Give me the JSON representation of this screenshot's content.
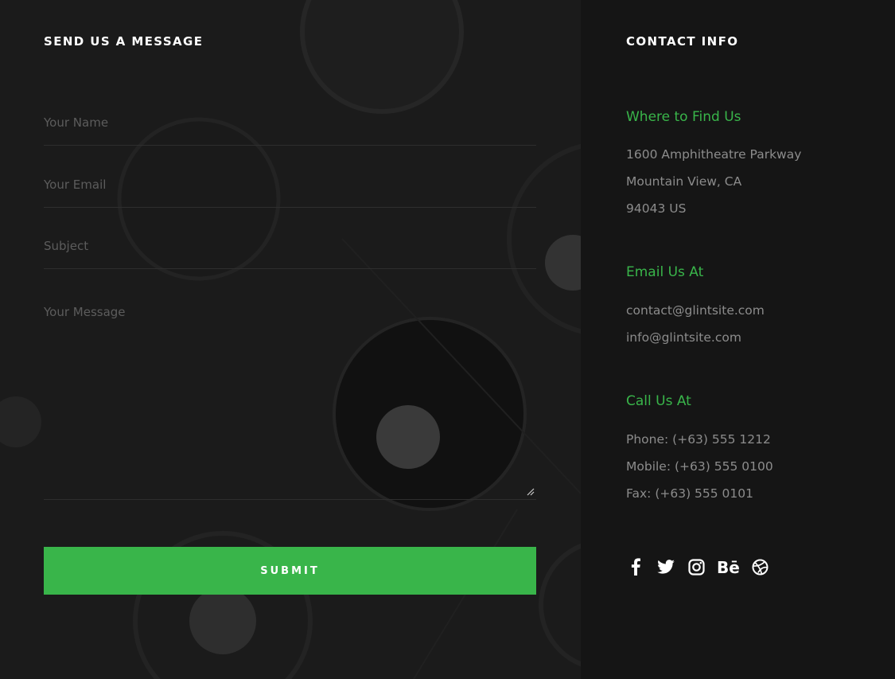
{
  "form": {
    "heading": "SEND US A MESSAGE",
    "name_placeholder": "Your Name",
    "email_placeholder": "Your Email",
    "subject_placeholder": "Subject",
    "message_placeholder": "Your Message",
    "submit_label": "SUBMIT"
  },
  "contact": {
    "heading": "CONTACT INFO",
    "location": {
      "title": "Where to Find Us",
      "lines": [
        "1600 Amphitheatre Parkway",
        "Mountain View, CA",
        "94043 US"
      ]
    },
    "email": {
      "title": "Email Us At",
      "lines": [
        "contact@glintsite.com",
        "info@glintsite.com"
      ]
    },
    "phone": {
      "title": "Call Us At",
      "lines": [
        "Phone: (+63) 555 1212",
        "Mobile: (+63) 555 0100",
        "Fax: (+63) 555 0101"
      ]
    }
  },
  "social": [
    "facebook-icon",
    "twitter-icon",
    "instagram-icon",
    "behance-icon",
    "dribbble-icon"
  ],
  "colors": {
    "accent": "#39b54a",
    "background": "#151515",
    "panel": "#1b1b1b"
  }
}
